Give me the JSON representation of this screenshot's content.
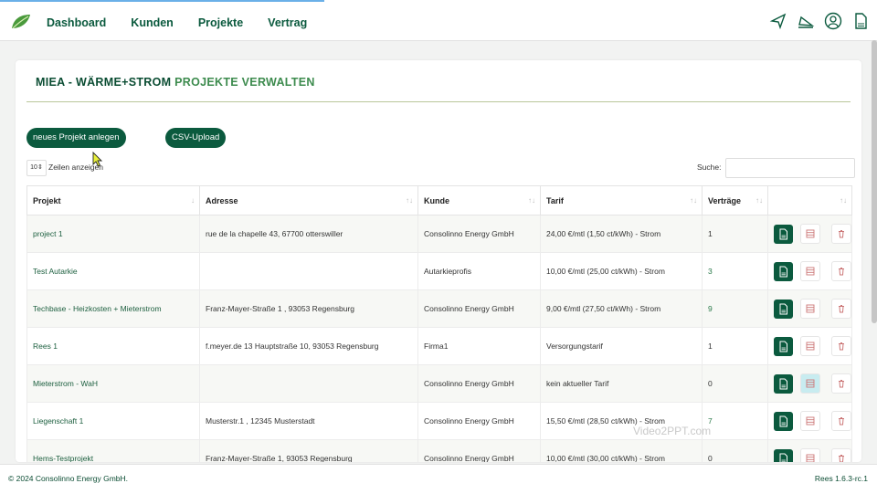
{
  "nav": {
    "items": [
      {
        "label": "Dashboard"
      },
      {
        "label": "Kunden"
      },
      {
        "label": "Projekte"
      },
      {
        "label": "Vertrag"
      }
    ],
    "icons": [
      "send-icon",
      "megaphone-icon",
      "user-circle-icon",
      "document-icon"
    ]
  },
  "page": {
    "title_part1": "MIEA - WÄRME+STROM",
    "title_part2": " PROJEKTE VERWALTEN"
  },
  "toolbar": {
    "new_project_label": "neues Projekt anlegen",
    "csv_upload_label": "CSV-Upload",
    "page_length_value": "10",
    "page_length_label": "Zeilen anzeigen",
    "search_label": "Suche:"
  },
  "table": {
    "columns": [
      {
        "label": "Projekt",
        "sort": "↓"
      },
      {
        "label": "Adresse",
        "sort": "↑↓"
      },
      {
        "label": "Kunde",
        "sort": "↑↓"
      },
      {
        "label": "Tarif",
        "sort": "↑↓"
      },
      {
        "label": "Verträge",
        "sort": "↑↓"
      },
      {
        "label": "",
        "sort": "↑↓"
      }
    ],
    "rows": [
      {
        "projekt": "project 1",
        "adresse": "rue de la chapelle 43, 67700 otterswiller",
        "kunde": "Consolinno Energy GmbH",
        "tarif": "24,00 €/mtl (1,50 ct/kWh) - Strom",
        "vertraege": "1"
      },
      {
        "projekt": "Test Autarkie",
        "adresse": "",
        "kunde": "Autarkieprofis",
        "tarif": "10,00 €/mtl (25,00 ct/kWh) - Strom",
        "vertraege": "3"
      },
      {
        "projekt": "Techbase - Heizkosten + Mieterstrom",
        "adresse": "Franz-Mayer-Straße 1 , 93053 Regensburg",
        "kunde": "Consolinno Energy GmbH",
        "tarif": "9,00 €/mtl (27,50 ct/kWh) - Strom",
        "vertraege": "9"
      },
      {
        "projekt": "Rees 1",
        "adresse": "f.meyer.de 13 Hauptstraße 10, 93053 Regensburg",
        "kunde": "Firma1",
        "tarif": "Versorgungstarif",
        "vertraege": "1"
      },
      {
        "projekt": "Mieterstrom - WaH",
        "adresse": "",
        "kunde": "Consolinno Energy GmbH",
        "tarif": "kein aktueller Tarif",
        "vertraege": "0"
      },
      {
        "projekt": "Liegenschaft 1",
        "adresse": "Musterstr.1 , 12345 Musterstadt",
        "kunde": "Consolinno Energy GmbH",
        "tarif": "15,50 €/mtl (28,50 ct/kWh) - Strom",
        "vertraege": "7"
      },
      {
        "projekt": "Hems-Testprojekt",
        "adresse": "Franz-Mayer-Straße 1, 93053 Regensburg",
        "kunde": "Consolinno Energy GmbH",
        "tarif": "10,00 €/mtl (30,00 ct/kWh) - Strom",
        "vertraege": "0"
      }
    ]
  },
  "footer": {
    "copyright": "© 2024 Consolinno Energy GmbH.",
    "version": "Rees 1.6.3-rc.1"
  },
  "watermark": "Video2PPT.com",
  "colors": {
    "brand": "#0b5a3e",
    "accent_light": "#3d8b4e",
    "highlight": "#c8ecf0"
  }
}
